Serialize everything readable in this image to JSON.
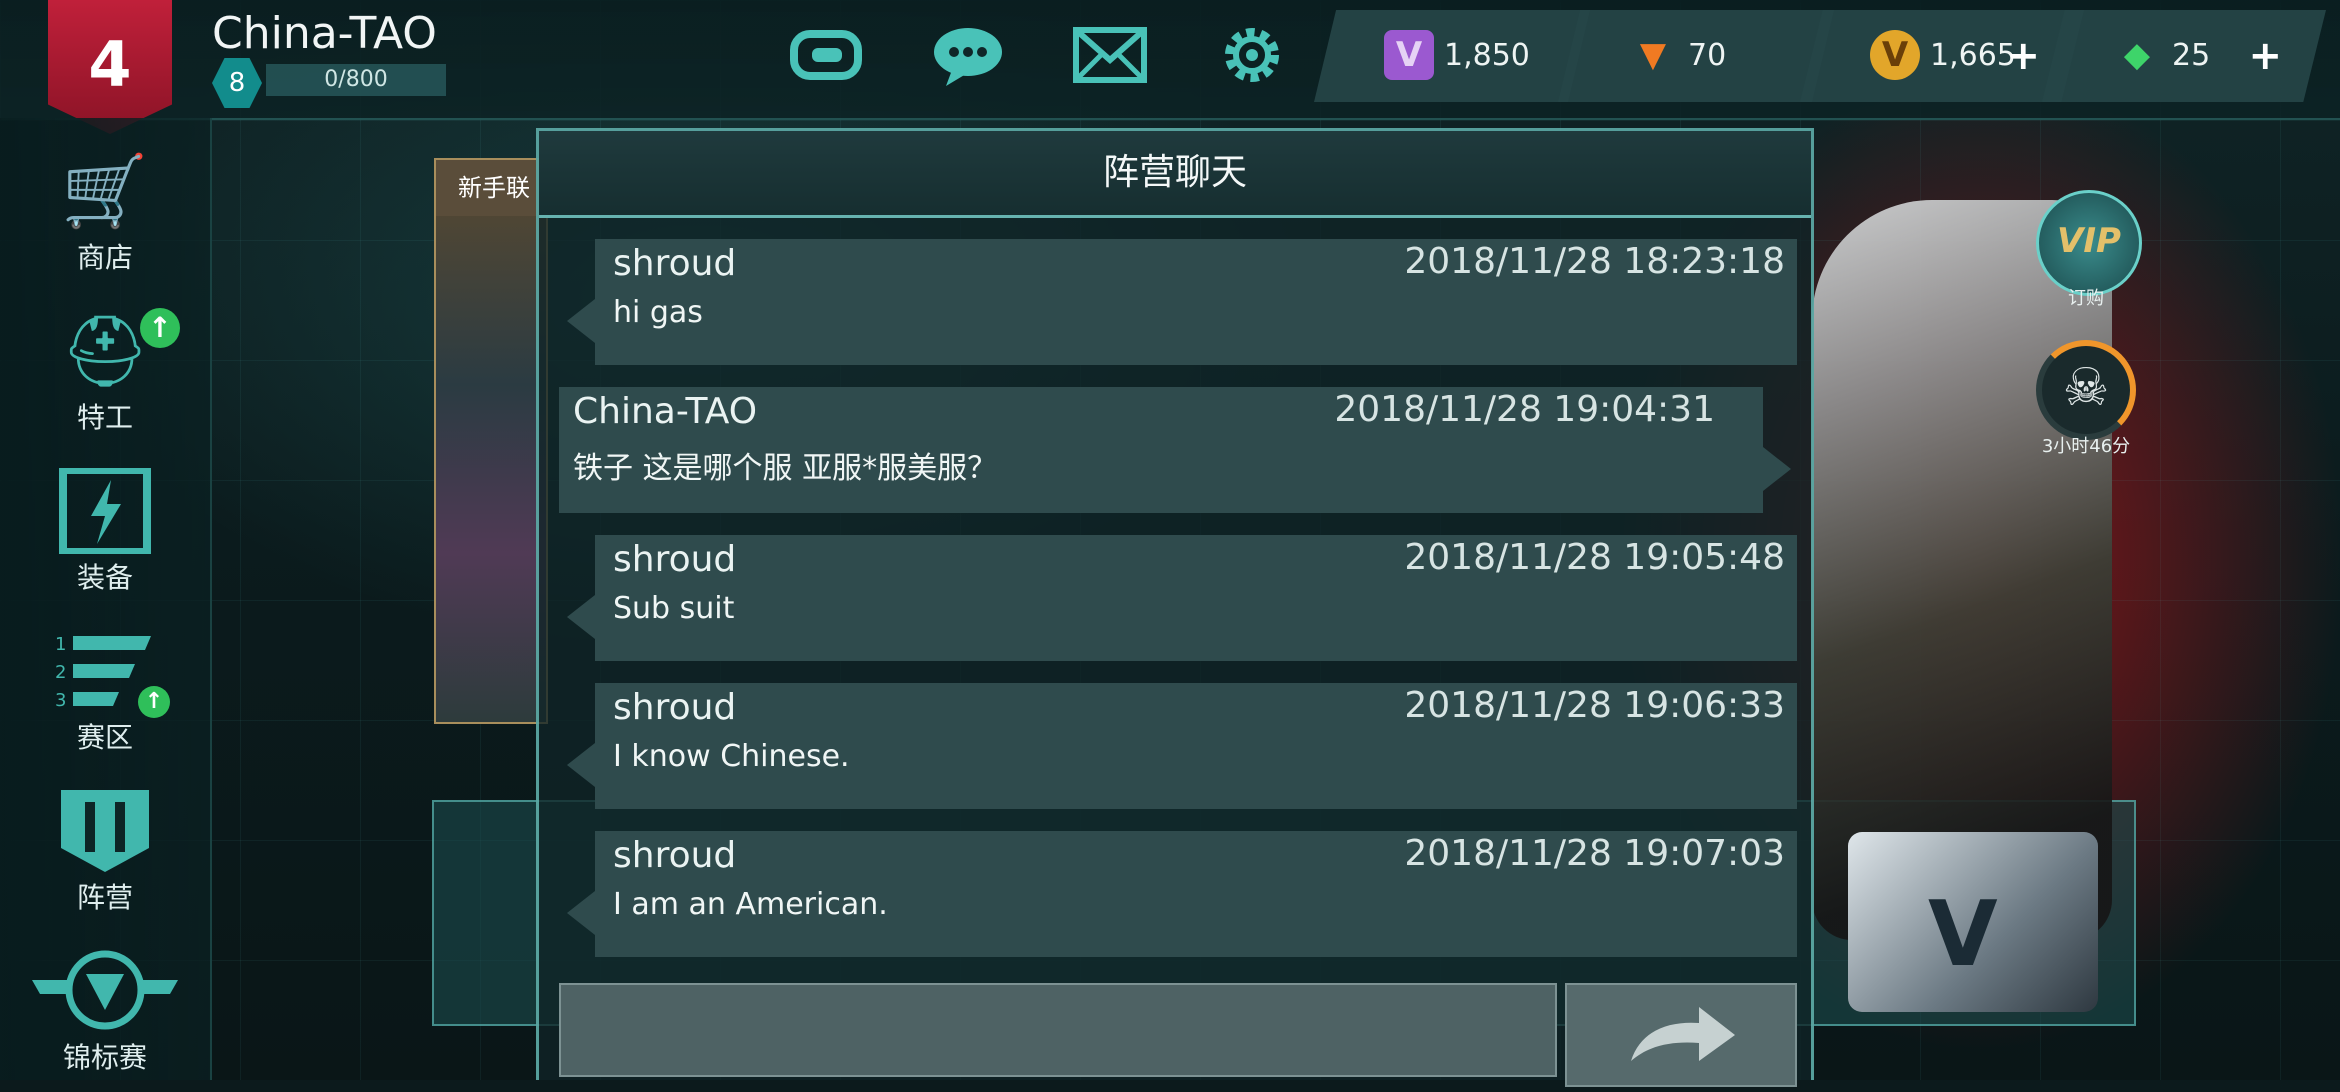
{
  "player": {
    "name": "China-TAO",
    "level": "8",
    "xp": "0/800",
    "logo_glyph": "4"
  },
  "topbar": {
    "icons": [
      "gameloft-icon",
      "chat-icon",
      "mail-icon",
      "settings-icon"
    ],
    "currencies": [
      {
        "name": "purple-v-currency",
        "value": "1,850",
        "color": "#9b59d0",
        "has_plus": false
      },
      {
        "name": "orange-v-currency",
        "value": "70",
        "color": "#f07a22",
        "has_plus": false
      },
      {
        "name": "gold-v-currency",
        "value": "1,665",
        "color": "#e2a62a",
        "has_plus": true
      },
      {
        "name": "diamond-currency",
        "value": "25",
        "color": "#3ed46a",
        "has_plus": true
      }
    ],
    "plus": "+"
  },
  "nav": {
    "items": [
      {
        "label": "商店",
        "icon": "cart-icon"
      },
      {
        "label": "特工",
        "icon": "agent-helmet-icon"
      },
      {
        "label": "装备",
        "icon": "equipment-icon"
      },
      {
        "label": "赛区",
        "icon": "division-icon"
      },
      {
        "label": "阵营",
        "icon": "faction-icon"
      },
      {
        "label": "锦标赛",
        "icon": "tournament-icon"
      }
    ]
  },
  "event_panel": {
    "title": "新手联"
  },
  "side_widgets": {
    "vip_text": "VIP",
    "vip_label": "订购",
    "timer_label": "3小时46分"
  },
  "chat": {
    "title": "阵营聊天",
    "messages": [
      {
        "sender": "shroud",
        "time": "2018/11/28 18:23:18",
        "text": "hi gas",
        "side": "left"
      },
      {
        "sender": "China-TAO",
        "time": "2018/11/28 19:04:31",
        "text": "铁子 这是哪个服 亚服*服美服？",
        "side": "right"
      },
      {
        "sender": "shroud",
        "time": "2018/11/28 19:05:48",
        "text": "Sub suit",
        "side": "left"
      },
      {
        "sender": "shroud",
        "time": "2018/11/28 19:06:33",
        "text": "I know Chinese.",
        "side": "left"
      },
      {
        "sender": "shroud",
        "time": "2018/11/28 19:07:03",
        "text": "I am an American.",
        "side": "left"
      }
    ],
    "input_value": "",
    "send_icon": "send-arrow-icon"
  }
}
